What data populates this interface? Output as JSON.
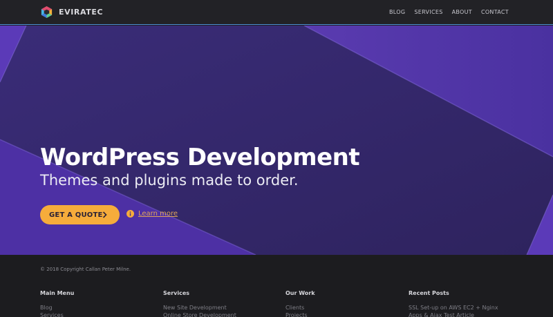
{
  "header": {
    "brand": "EVIRATEC",
    "nav": [
      "BLOG",
      "SERVICES",
      "ABOUT",
      "CONTACT"
    ]
  },
  "hero": {
    "title": "WordPress Development",
    "subtitle": "Themes and plugins made to order.",
    "cta_label": "GET A QUOTE",
    "cta_icon": "chevron-right-icon",
    "learn_more_label": "Learn more",
    "learn_more_icon": "info-icon"
  },
  "footer": {
    "copyright": "© 2018 Copyright Callan Peter Milne.",
    "columns": [
      {
        "title": "Main Menu",
        "links": [
          "Blog",
          "Services"
        ]
      },
      {
        "title": "Services",
        "links": [
          "New Site Development",
          "Online Store Development"
        ]
      },
      {
        "title": "Our Work",
        "links": [
          "Clients",
          "Projects"
        ]
      },
      {
        "title": "Recent Posts",
        "links": [
          "SSL Set-up on AWS EC2 + Nginx",
          "Apps & Ajax Test Article"
        ]
      }
    ]
  },
  "colors": {
    "hero_bg": "#3f2a86",
    "accent": "#f6ac3b",
    "topbar": "#222226",
    "footer": "#1c1c1f",
    "topbar_border": "#4d8fd6"
  }
}
